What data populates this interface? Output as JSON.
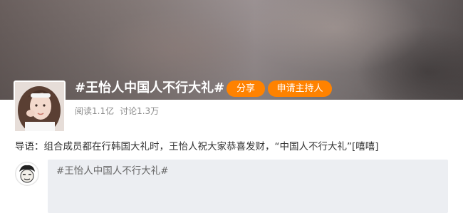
{
  "topic": {
    "title": "#王怡人中国人不行大礼#",
    "share_label": "分享",
    "host_label": "申请主持人",
    "reads": "阅读1.1亿",
    "discussions": "讨论1.3万",
    "guide": "导语：组合成员都在行韩国大礼时，王怡人祝大家恭喜发财，“中国人不行大礼”[嘻嘻]"
  },
  "composer": {
    "text": "#王怡人中国人不行大礼#"
  },
  "colors": {
    "accent": "#ff8200",
    "stats_text": "#8a8a8a",
    "composer_bg": "#eceef2"
  },
  "icons": {
    "avatar": "portrait-photo",
    "user_avatar": "cartoon-face-avatar"
  }
}
